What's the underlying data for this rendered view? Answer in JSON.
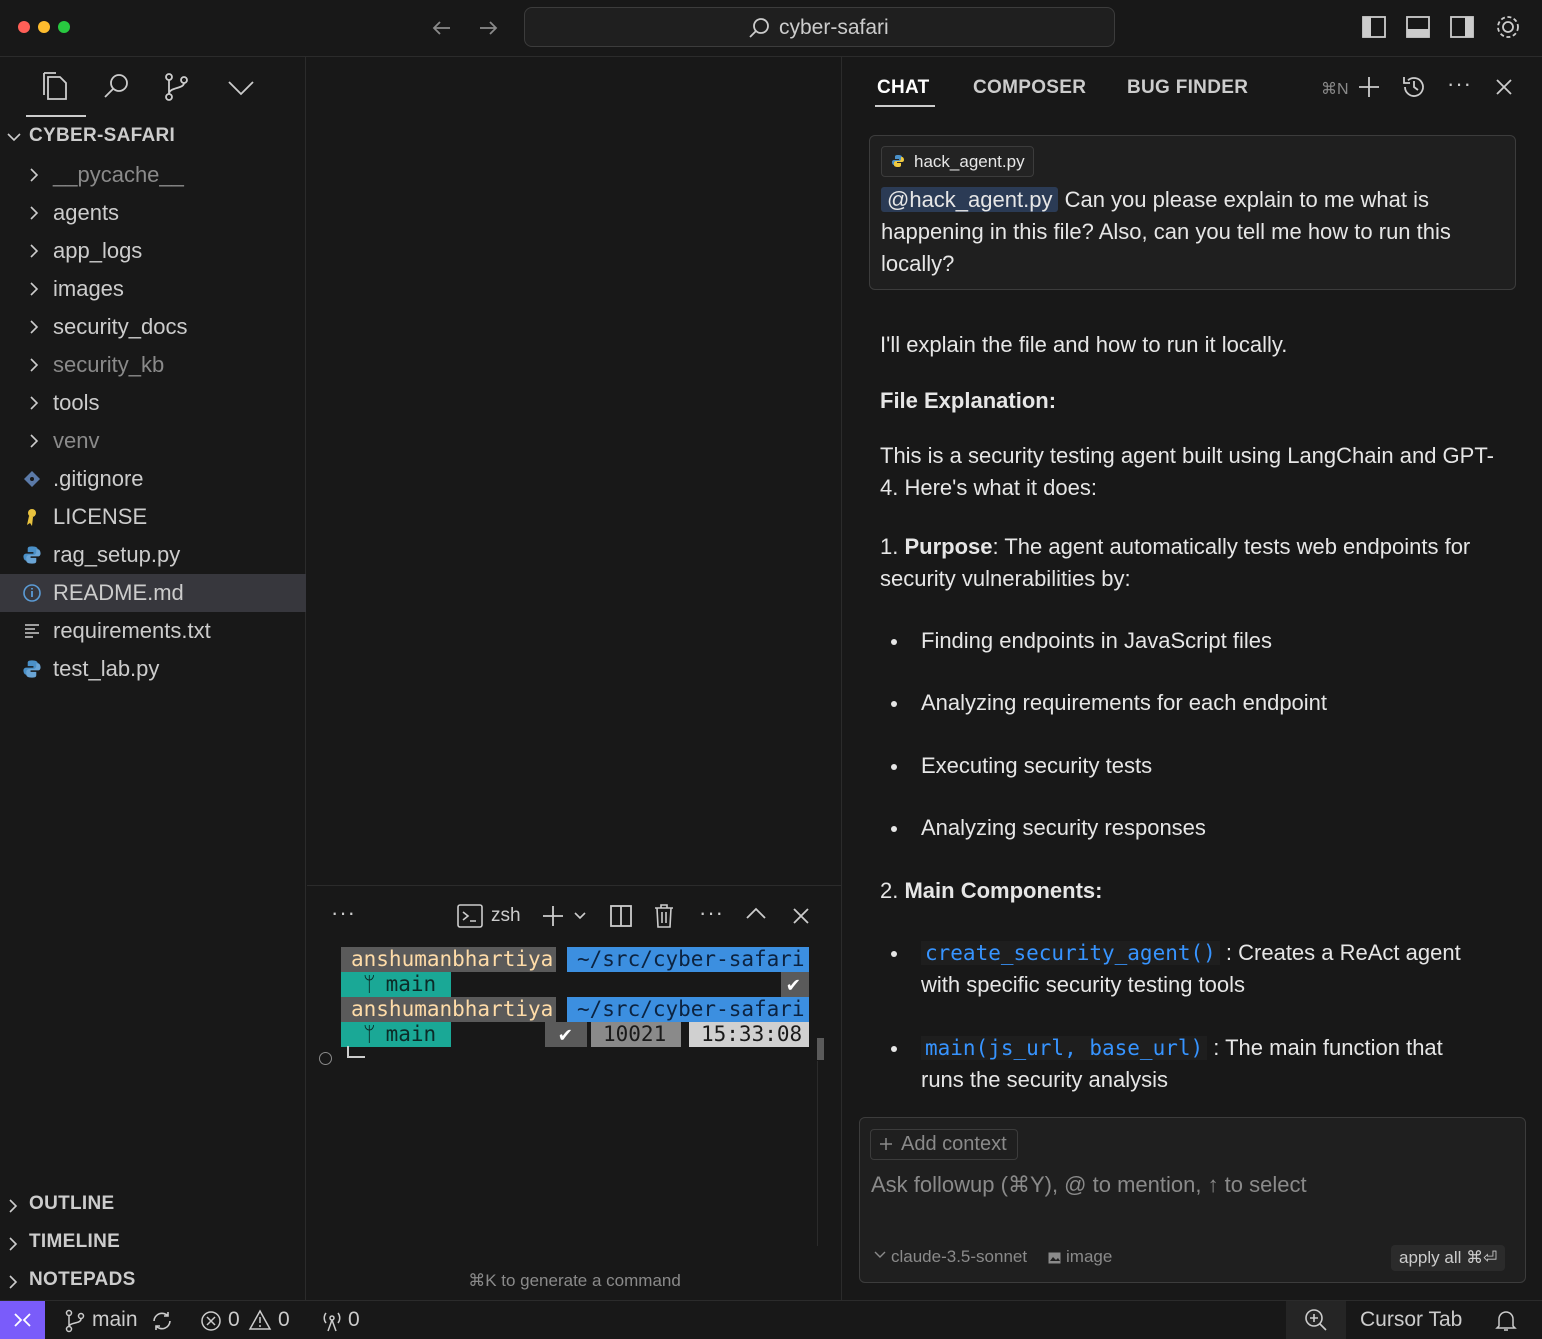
{
  "window": {
    "title": "cyber-safari",
    "traffic_colors": [
      "#ff5f57",
      "#febc2e",
      "#28c840"
    ]
  },
  "sidebar": {
    "root_label": "CYBER-SAFARI",
    "items": [
      {
        "label": "__pycache__",
        "type": "folder",
        "dim": true
      },
      {
        "label": "agents",
        "type": "folder",
        "dim": false
      },
      {
        "label": "app_logs",
        "type": "folder",
        "dim": false
      },
      {
        "label": "images",
        "type": "folder",
        "dim": false
      },
      {
        "label": "security_docs",
        "type": "folder",
        "dim": false
      },
      {
        "label": "security_kb",
        "type": "folder",
        "dim": true
      },
      {
        "label": "tools",
        "type": "folder",
        "dim": false
      },
      {
        "label": "venv",
        "type": "folder",
        "dim": true
      },
      {
        "label": ".gitignore",
        "type": "git-icon",
        "dim": false
      },
      {
        "label": "LICENSE",
        "type": "license-icon",
        "dim": false
      },
      {
        "label": "rag_setup.py",
        "type": "python-icon",
        "dim": false
      },
      {
        "label": "README.md",
        "type": "info-icon",
        "dim": false,
        "selected": true
      },
      {
        "label": "requirements.txt",
        "type": "text-file-icon",
        "dim": false
      },
      {
        "label": "test_lab.py",
        "type": "python-icon",
        "dim": false
      }
    ],
    "sections": [
      "OUTLINE",
      "TIMELINE",
      "NOTEPADS"
    ]
  },
  "terminal": {
    "shell": "zsh",
    "lines": [
      {
        "user": "anshumanbhartiya",
        "path": "~/src/cyber-safari",
        "branch": "main",
        "status": "✔"
      },
      {
        "user": "anshumanbhartiya",
        "path": "~/src/cyber-safari",
        "branch": "main",
        "status": "✔",
        "code": "10021",
        "time": "15:33:08"
      }
    ],
    "hint": "⌘K to generate a command"
  },
  "chat": {
    "tabs": [
      "CHAT",
      "COMPOSER",
      "BUG FINDER"
    ],
    "new_shortcut": "⌘N",
    "context_file": "hack_agent.py",
    "user_mention": "@hack_agent.py",
    "user_text": "Can you please explain to me what is happening in this file? Also, can you tell me how to run this locally?",
    "answer": {
      "intro": "I'll explain the file and how to run it locally.",
      "heading": "File Explanation:",
      "description": "This is a security testing agent built using LangChain and GPT-4. Here's what it does:",
      "p1_num": "1. ",
      "p1_bold": "Purpose",
      "p1_text": ": The agent automatically tests web endpoints for security vulnerabilities by:",
      "bullets": [
        "Finding endpoints in JavaScript files",
        "Analyzing requirements for each endpoint",
        "Executing security tests",
        "Analyzing security responses"
      ],
      "p2_num": "2. ",
      "p2_bold": "Main Components:",
      "components": [
        {
          "code": "create_security_agent()",
          "text": " : Creates a ReAct agent with specific security testing tools"
        },
        {
          "code": "main(js_url, base_url)",
          "text": " : The main function that runs the security analysis"
        }
      ]
    },
    "input": {
      "add_context": "Add context",
      "placeholder": "Ask followup (⌘Y), @ to mention, ↑ to select",
      "model": "claude-3.5-sonnet",
      "image_label": "image",
      "apply_all": "apply all ⌘⏎"
    }
  },
  "statusbar": {
    "branch": "main",
    "errors": "0",
    "warnings": "0",
    "ports": "0",
    "cursor_tab": "Cursor Tab",
    "remote_color": "#7a5cfa"
  }
}
